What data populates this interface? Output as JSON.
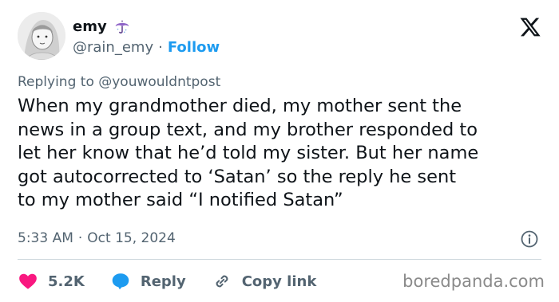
{
  "author": {
    "name": "emy",
    "emoji_icon": "umbrella-with-rain-icon",
    "handle": "@rain_emy",
    "separator": "·",
    "follow_label": "Follow"
  },
  "reply_context": "Replying to @youwouldntpost",
  "tweet": {
    "text": "When my grandmother died, my mother sent the\nnews in a group text, and my brother responded to\nlet her know that he’d told my sister. But her name\ngot autocorrected to ‘Satan’ so the reply he sent\nto my mother said “I notified Satan”"
  },
  "meta": {
    "time": "5:33 AM",
    "separator": "·",
    "date": "Oct 15, 2024"
  },
  "actions": {
    "likes": "5.2K",
    "reply_label": "Reply",
    "copy_label": "Copy link"
  },
  "watermark": "boredpanda.com",
  "colors": {
    "like_red": "#f91880",
    "blue": "#1d9bf0",
    "secondary_text": "#536471"
  }
}
